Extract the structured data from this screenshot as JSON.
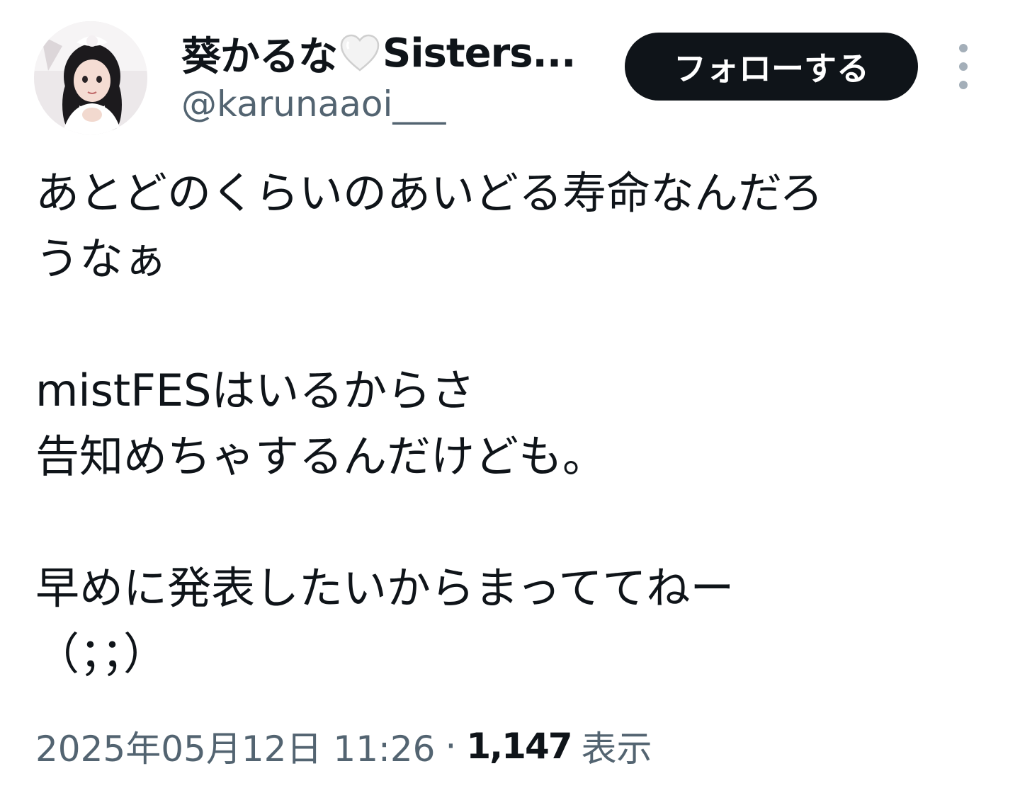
{
  "author": {
    "display_name_prefix": "葵かるな",
    "heart_icon": "white-heart-icon",
    "display_name_suffix": "Sisters...",
    "handle": "@karunaaoi___",
    "avatar": "profile-photo"
  },
  "actions": {
    "follow_label": "フォローする",
    "more_icon": "more-vertical-icon"
  },
  "tweet": {
    "lines": [
      "あとどのくらいのあいどる寿命なんだろ",
      "うなぁ",
      "",
      "mistFESはいるからさ",
      "告知めちゃするんだけども。",
      "",
      "早めに発表したいからまっててねー",
      "（；；）"
    ]
  },
  "meta": {
    "timestamp": "2025年05月12日 11:26",
    "separator": "·",
    "views_count": "1,147",
    "views_label": "表示"
  },
  "colors": {
    "text_primary": "#0f1419",
    "text_secondary": "#536471",
    "button_bg": "#0f1419",
    "button_text": "#ffffff"
  }
}
